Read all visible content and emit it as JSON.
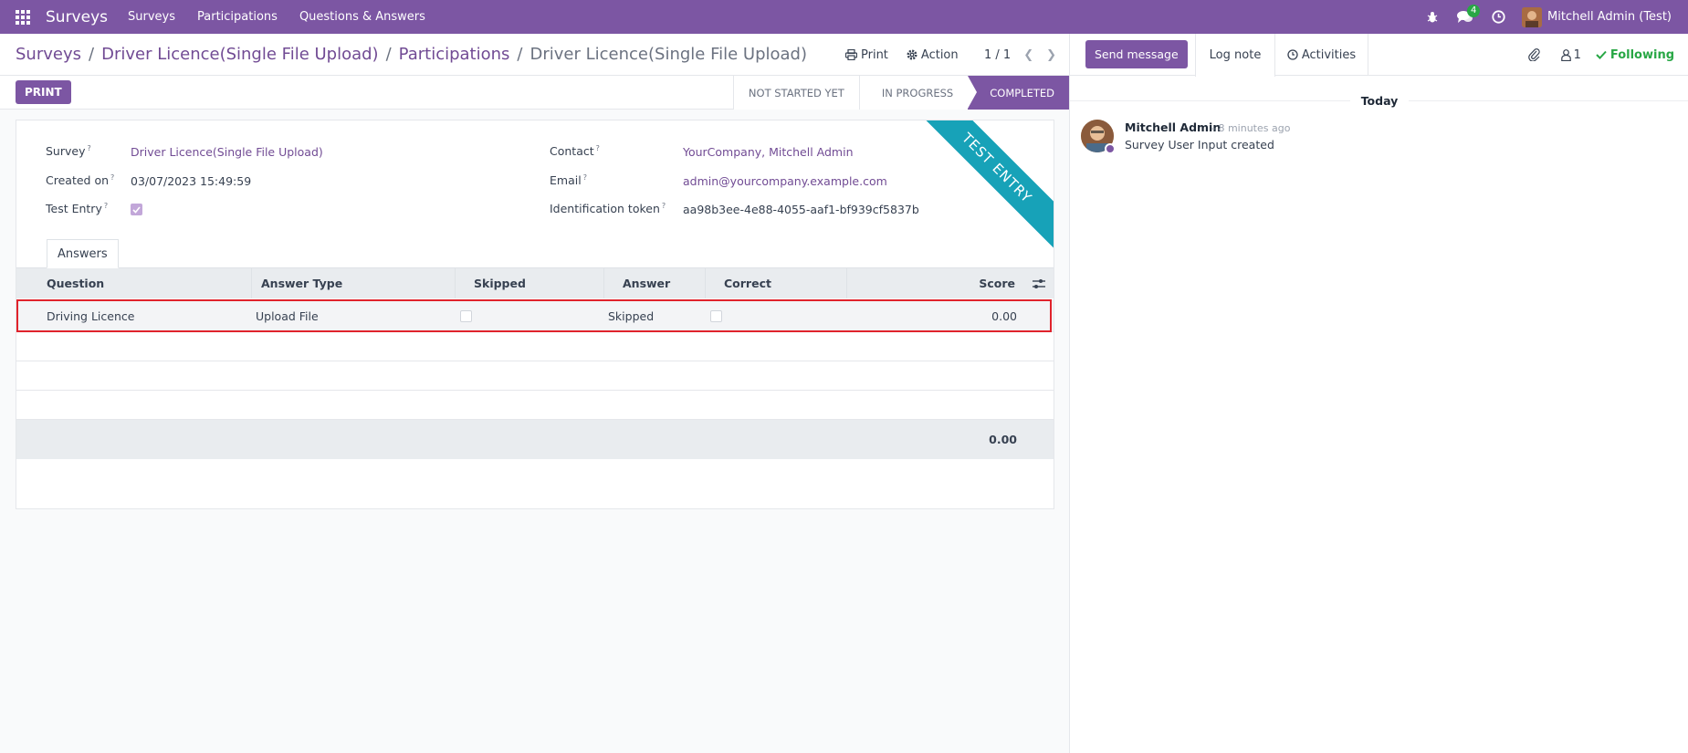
{
  "navbar": {
    "brand": "Surveys",
    "menus": [
      "Surveys",
      "Participations",
      "Questions & Answers"
    ],
    "messages_badge": "4",
    "user_name": "Mitchell Admin (Test)"
  },
  "breadcrumb": {
    "items": [
      "Surveys",
      "Driver Licence(Single File Upload)",
      "Participations"
    ],
    "current": "Driver Licence(Single File Upload)"
  },
  "actions": {
    "print": "Print",
    "action": "Action",
    "pager": "1 / 1"
  },
  "statusbar": {
    "print_button": "PRINT",
    "stages": [
      "NOT STARTED YET",
      "IN PROGRESS",
      "COMPLETED"
    ],
    "active_stage": "COMPLETED"
  },
  "form": {
    "ribbon": "TEST ENTRY",
    "survey_label": "Survey",
    "survey_value": "Driver Licence(Single File Upload)",
    "created_label": "Created on",
    "created_value": "03/07/2023 15:49:59",
    "test_entry_label": "Test Entry",
    "test_entry_checked": true,
    "contact_label": "Contact",
    "contact_value": "YourCompany, Mitchell Admin",
    "email_label": "Email",
    "email_value": "admin@yourcompany.example.com",
    "token_label": "Identification token",
    "token_value": "aa98b3ee-4e88-4055-aaf1-bf939cf5837b",
    "help_mark": "?"
  },
  "answers_tab": "Answers",
  "table": {
    "headers": [
      "Question",
      "Answer Type",
      "Skipped",
      "Answer",
      "Correct",
      "Score"
    ],
    "rows": [
      {
        "question": "Driving Licence",
        "answer_type": "Upload File",
        "skipped": false,
        "answer": "Skipped",
        "correct": false,
        "score": "0.00"
      }
    ],
    "total": "0.00"
  },
  "chatter": {
    "send_message": "Send message",
    "log_note": "Log note",
    "activities": "Activities",
    "followers_count": "1",
    "following": "Following",
    "today": "Today",
    "message": {
      "author": "Mitchell Admin",
      "time": "- 8 minutes ago",
      "body": "Survey User Input created"
    }
  },
  "colors": {
    "brand": "#7c56a3",
    "link": "#714b94",
    "ribbon": "#17a2b8",
    "following": "#28a745",
    "highlight": "#e0232c"
  }
}
